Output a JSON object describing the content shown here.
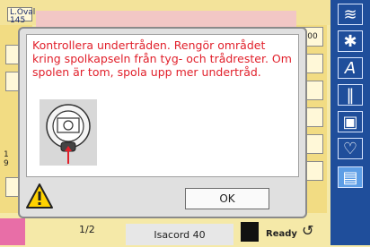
{
  "hoop": {
    "label": "L.Oval",
    "number": "145"
  },
  "side_values": {
    "left_top": "1",
    "left_bottom": "9",
    "right_top": "00"
  },
  "dialog": {
    "message": "Kontrollera undertråden. Rengör området kring spolkapseln från tyg- och trådrester. Om spolen är tom, spola upp mer undertråd.",
    "ok_label": "OK"
  },
  "status": {
    "page": "1/2",
    "thread": "Isacord 40",
    "ready": "Ready"
  },
  "colors": {
    "toolbar": "#1f4e9b",
    "accent_pink": "#e86ea7",
    "warning_text": "#e11f2a"
  },
  "toolbar_icons": [
    "zigzag-icon",
    "bobbin-thread-icon",
    "alphabet-icon",
    "straight-stitch-icon",
    "frame-icon",
    "heart-icon",
    "embroidery-icon"
  ]
}
